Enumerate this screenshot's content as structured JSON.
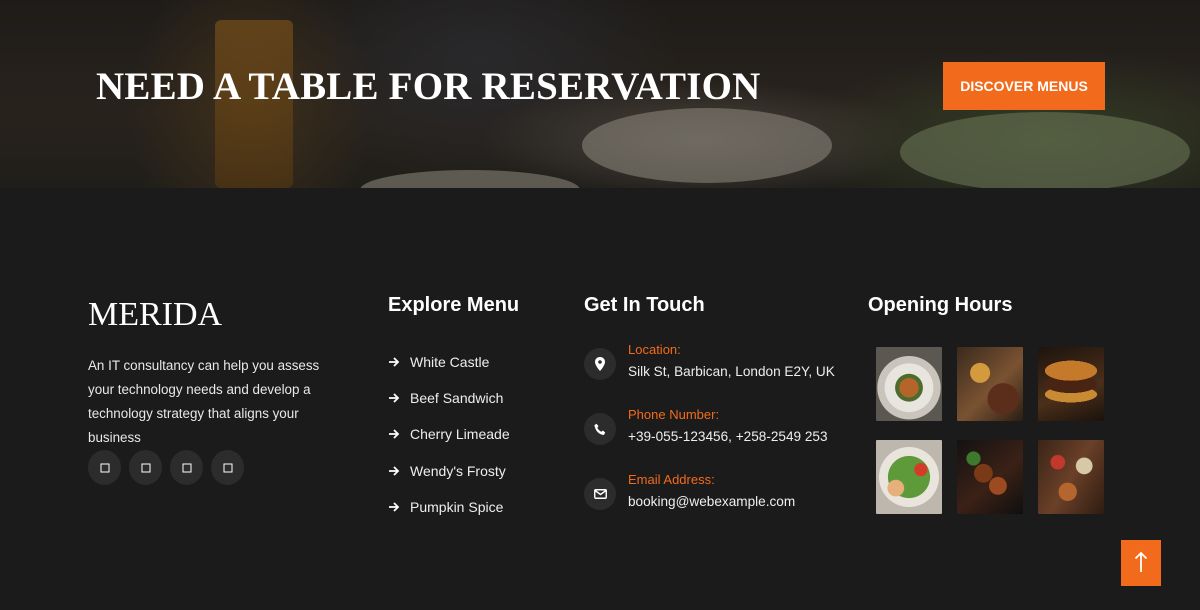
{
  "hero": {
    "title": "NEED A TABLE FOR RESERVATION",
    "button_label": "DISCOVER MENUS"
  },
  "brand": {
    "name": "MERIDA",
    "description": "An IT consultancy can help you assess your technology needs and develop a technology strategy that aligns your business",
    "social_icons": [
      "facebook-icon",
      "twitter-icon",
      "instagram-icon",
      "linkedin-icon"
    ]
  },
  "explore_menu": {
    "title": "Explore Menu",
    "items": [
      "White Castle",
      "Beef Sandwich",
      "Cherry Limeade",
      "Wendy's Frosty",
      "Pumpkin Spice"
    ]
  },
  "get_in_touch": {
    "title": "Get In Touch",
    "items": [
      {
        "icon": "location-pin-icon",
        "label": "Location:",
        "value": "Silk St, Barbican, London E2Y, UK"
      },
      {
        "icon": "phone-icon",
        "label": "Phone Number:",
        "value": "+39-055-123456, +258-2549 253"
      },
      {
        "icon": "email-icon",
        "label": "Email Address:",
        "value": "booking@webexample.com"
      }
    ]
  },
  "opening_hours": {
    "title": "Opening Hours",
    "images": [
      "pasta-dish-photo",
      "grilled-food-photo",
      "burger-fries-photo",
      "salad-bowl-photo",
      "grilled-meat-photo",
      "food-platter-photo"
    ]
  },
  "colors": {
    "accent": "#f26b1d",
    "background": "#1b1b1b",
    "icon_circle": "#2c2c2c"
  },
  "scroll_top_icon": "arrow-up-icon"
}
